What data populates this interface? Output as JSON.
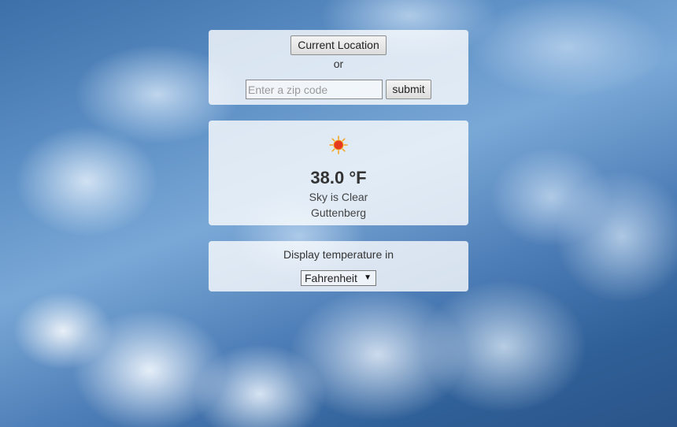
{
  "location_panel": {
    "current_location_label": "Current Location",
    "or_text": "or",
    "zip_placeholder": "Enter a zip code",
    "zip_value": "",
    "submit_label": "submit"
  },
  "weather": {
    "icon": "sun-icon",
    "temperature": "38.0 °F",
    "description": "Sky is Clear",
    "city": "Guttenberg"
  },
  "units": {
    "label": "Display temperature in",
    "selected": "Fahrenheit"
  },
  "colors": {
    "panel_background": "#ffffff",
    "sun": "#e53a1e",
    "sun_rays": "#f5a623"
  }
}
